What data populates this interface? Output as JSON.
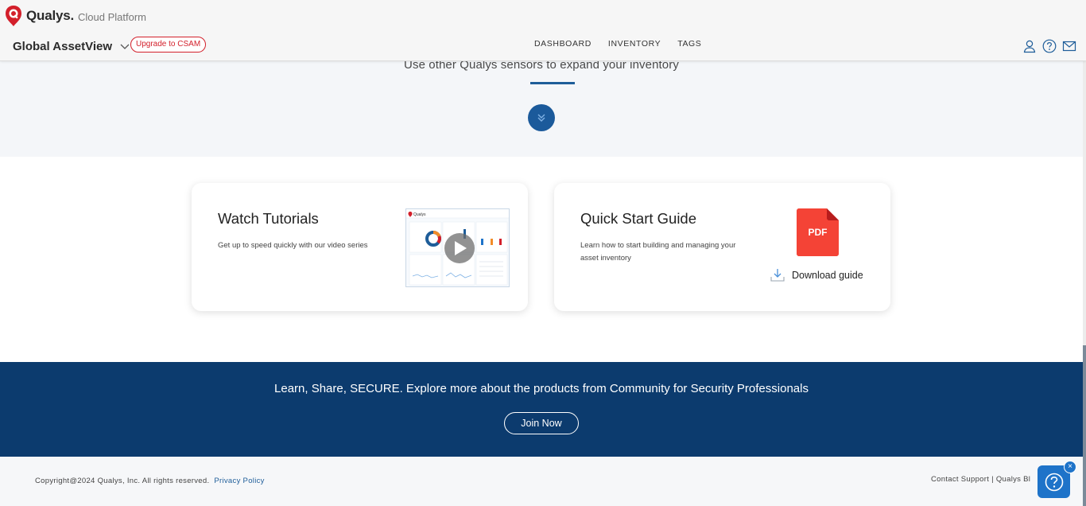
{
  "header": {
    "brand_name": "Qualys.",
    "brand_sub": "Cloud Platform",
    "app_title": "Global AssetView",
    "upgrade_label": "Upgrade to CSAM",
    "tabs": [
      {
        "label": "DASHBOARD"
      },
      {
        "label": "INVENTORY"
      },
      {
        "label": "TAGS"
      }
    ],
    "icons": [
      "user-icon",
      "help-icon",
      "mail-icon"
    ]
  },
  "sensors": {
    "text": "Use other Qualys sensors to expand your inventory",
    "expand_icon": "double-chevron-down-icon"
  },
  "cards": {
    "tutorials": {
      "title": "Watch Tutorials",
      "description": "Get up to speed quickly with our video series",
      "thumb_logo": "Qualys"
    },
    "guide": {
      "title": "Quick Start Guide",
      "description": "Learn how to start building and managing your asset inventory",
      "pdf_label": "PDF",
      "download_label": "Download guide"
    }
  },
  "community": {
    "text": "Learn, Share, SECURE. Explore more about the products from Community for Security Professionals",
    "join_label": "Join Now"
  },
  "footer": {
    "copyright": "Copyright@2024 Qualys, Inc. All rights reserved.",
    "privacy_label": "Privacy Policy",
    "contact_label": "Contact Support",
    "separator": "|",
    "blog_label": "Qualys Bl"
  },
  "help_widget": {
    "close_label": "×",
    "icon": "question-icon"
  },
  "colors": {
    "brand_red": "#d3202b",
    "primary_blue": "#1b5a9b",
    "banner_navy": "#0c3b6e",
    "pdf_red": "#f44336"
  }
}
